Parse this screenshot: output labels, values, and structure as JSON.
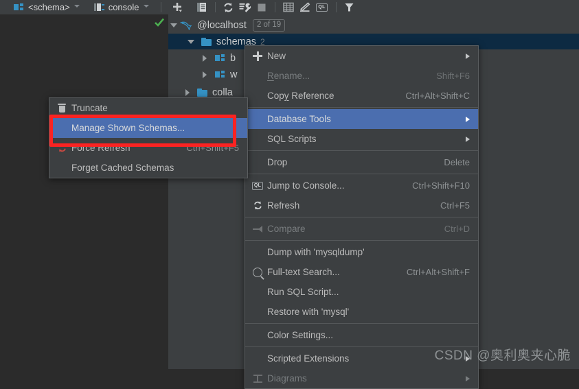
{
  "toolbar": {
    "tabs": [
      {
        "label": "<schema>",
        "icon": "schema-icon"
      },
      {
        "label": "console",
        "icon": "console-icon"
      }
    ],
    "buttons": [
      {
        "name": "add-button",
        "icon": "plus-dropdown-icon"
      },
      {
        "name": "properties-button",
        "icon": "document-icon"
      },
      {
        "name": "refresh-button",
        "icon": "refresh-icon"
      },
      {
        "name": "datasource-properties-button",
        "icon": "wrench-icon"
      },
      {
        "name": "stop-button",
        "icon": "stop-square-icon"
      },
      {
        "name": "table-button",
        "icon": "grid-icon"
      },
      {
        "name": "modify-button",
        "icon": "pencil-icon"
      },
      {
        "name": "jump-to-query-console-button",
        "icon": "ql-icon",
        "label": "QL"
      },
      {
        "name": "filter-button",
        "icon": "funnel-icon"
      }
    ]
  },
  "tree": {
    "connection": {
      "label": "@localhost",
      "badge": "2 of 19",
      "icon": "mysql-dolphin-icon"
    },
    "schemas_node": {
      "label": "schemas",
      "count": "2",
      "selected": true
    },
    "children": [
      {
        "label": "b",
        "icon": "schema-icon"
      },
      {
        "label": "w",
        "icon": "schema-icon"
      },
      {
        "label": "colla",
        "icon": "folder-icon"
      }
    ]
  },
  "context_menu": {
    "items": [
      {
        "label": "New",
        "shortcut": "",
        "icon": "plus-icon",
        "submenu": true,
        "enabled": true
      },
      {
        "label": "Rename...",
        "shortcut": "Shift+F6",
        "icon": "",
        "submenu": false,
        "enabled": false,
        "mnemonic": "R"
      },
      {
        "label": "Copy Reference",
        "shortcut": "Ctrl+Alt+Shift+C",
        "icon": "",
        "submenu": false,
        "enabled": true,
        "mnemonic": "y"
      },
      {
        "separator": true
      },
      {
        "label": "Database Tools",
        "shortcut": "",
        "icon": "",
        "submenu": true,
        "enabled": true,
        "highlighted": true
      },
      {
        "label": "SQL Scripts",
        "shortcut": "",
        "icon": "",
        "submenu": true,
        "enabled": true
      },
      {
        "separator": true
      },
      {
        "label": "Drop",
        "shortcut": "Delete",
        "icon": "",
        "submenu": false,
        "enabled": true
      },
      {
        "separator": true
      },
      {
        "label": "Jump to Console...",
        "shortcut": "Ctrl+Shift+F10",
        "icon": "ql-icon",
        "submenu": false,
        "enabled": true
      },
      {
        "label": "Refresh",
        "shortcut": "Ctrl+F5",
        "icon": "refresh-icon",
        "submenu": false,
        "enabled": true
      },
      {
        "separator": true
      },
      {
        "label": "Compare",
        "shortcut": "Ctrl+D",
        "icon": "compare-icon",
        "submenu": false,
        "enabled": false
      },
      {
        "separator": true
      },
      {
        "label": "Dump with 'mysqldump'",
        "shortcut": "",
        "icon": "",
        "submenu": false,
        "enabled": true
      },
      {
        "label": "Full-text Search...",
        "shortcut": "Ctrl+Alt+Shift+F",
        "icon": "search-icon",
        "submenu": false,
        "enabled": true
      },
      {
        "label": "Run SQL Script...",
        "shortcut": "",
        "icon": "",
        "submenu": false,
        "enabled": true
      },
      {
        "label": "Restore with 'mysql'",
        "shortcut": "",
        "icon": "",
        "submenu": false,
        "enabled": true
      },
      {
        "separator": true
      },
      {
        "label": "Color Settings...",
        "shortcut": "",
        "icon": "",
        "submenu": false,
        "enabled": true
      },
      {
        "separator": true
      },
      {
        "label": "Scripted Extensions",
        "shortcut": "",
        "icon": "",
        "submenu": true,
        "enabled": true
      },
      {
        "label": "Diagrams",
        "shortcut": "",
        "icon": "diagram-icon",
        "submenu": true,
        "enabled": false
      }
    ]
  },
  "database_tools_submenu": {
    "items": [
      {
        "label": "Truncate",
        "shortcut": "",
        "icon": "trash-icon",
        "enabled": true
      },
      {
        "label": "Manage Shown Schemas...",
        "shortcut": "",
        "icon": "",
        "enabled": true,
        "highlighted": true
      },
      {
        "label": "Force Refresh",
        "shortcut": "Ctrl+Shift+F5",
        "icon": "force-refresh-icon",
        "enabled": true
      },
      {
        "label": "Forget Cached Schemas",
        "shortcut": "",
        "icon": "",
        "enabled": true
      }
    ]
  },
  "annotation": {
    "highlight_color": "#fb2322",
    "target_label": "Manage Shown Schemas..."
  },
  "watermark": {
    "text": "CSDN @奥利奥夹心脆"
  },
  "colors": {
    "panel_bg": "#3c3f41",
    "editor_bg": "#2b2b2b",
    "selection_blue": "#4b6eaf",
    "tree_selection": "#0d2a42",
    "accent_blue": "#3592c4"
  }
}
